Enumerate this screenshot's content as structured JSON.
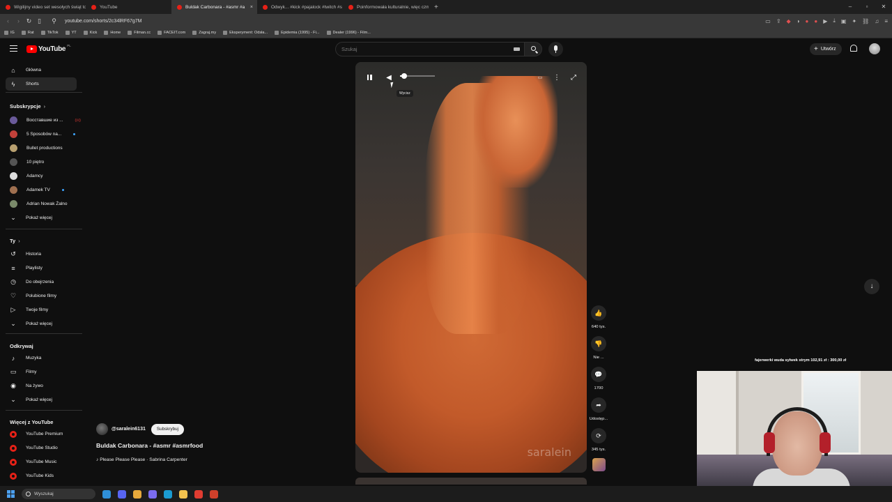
{
  "browser": {
    "tabs": [
      {
        "label": "Wigilijny video set wesołych świąt to",
        "active": false,
        "icon_color": "#e62117"
      },
      {
        "label": "YouTube",
        "active": false,
        "icon_color": "#e62117"
      },
      {
        "label": "Buldak Carbonara - #asmr #a",
        "active": true,
        "icon_color": "#e62117"
      },
      {
        "label": "Odwyk... #kick #pajalock #twitch #s",
        "active": false,
        "icon_color": "#e62117"
      },
      {
        "label": "Poinformowała kulturalnie, więc czm",
        "active": false,
        "icon_color": "#e62117"
      }
    ],
    "new_tab": "+",
    "url": "youtube.com/shorts/2c34lRF67g7M",
    "bookmarks": [
      "IG",
      "Rat",
      "TikTok",
      "YT",
      "Kick",
      "Home",
      "Filman.cc",
      "FACEIT.com",
      "Zagraj.my",
      "Eksperyment: Odsła...",
      "Epidemia (1995) - Fi...",
      "Dealer (1996) - Film..."
    ]
  },
  "youtube": {
    "logo_text": "YouTube",
    "logo_country": "PL",
    "search_placeholder": "Szukaj",
    "create_label": "Utwórz",
    "create_plus": "+",
    "sidebar": {
      "main": [
        {
          "label": "Główna",
          "icon": "home-icon",
          "glyph": "⌂",
          "active": false
        },
        {
          "label": "Shorts",
          "icon": "shorts-icon",
          "glyph": "ϟ",
          "active": true
        }
      ],
      "subs_header": "Subskrypcje",
      "subscriptions": [
        {
          "label": "Восставшие из ...",
          "color": "#6a5a9a",
          "live": true,
          "dot": false
        },
        {
          "label": "5 Sposobów na...",
          "color": "#c2413a",
          "live": false,
          "dot": true
        },
        {
          "label": "Bullet productions",
          "color": "#b8a070",
          "live": false,
          "dot": false
        },
        {
          "label": "10 piętro",
          "color": "#555555",
          "live": false,
          "dot": false
        },
        {
          "label": "Adamcy",
          "color": "#dddddd",
          "live": false,
          "dot": false
        },
        {
          "label": "Adamek TV",
          "color": "#a07050",
          "live": false,
          "dot": true
        },
        {
          "label": "Adrian Nowak Żalno",
          "color": "#7a8a6a",
          "live": false,
          "dot": false
        }
      ],
      "subs_more": "Pokaż więcej",
      "you_header": "Ty",
      "you": [
        {
          "label": "Historia",
          "glyph": "↺"
        },
        {
          "label": "Playlisty",
          "glyph": "≡"
        },
        {
          "label": "Do obejrzenia",
          "glyph": "◷"
        },
        {
          "label": "Polubione filmy",
          "glyph": "♡"
        },
        {
          "label": "Twoje filmy",
          "glyph": "▷"
        },
        {
          "label": "Pokaż więcej",
          "glyph": "⌄"
        }
      ],
      "explore_header": "Odkrywaj",
      "explore": [
        {
          "label": "Muzyka",
          "glyph": "♪"
        },
        {
          "label": "Filmy",
          "glyph": "▭"
        },
        {
          "label": "Na żywo",
          "glyph": "◉"
        },
        {
          "label": "Pokaż więcej",
          "glyph": "⌄"
        }
      ],
      "more_header": "Więcej z YouTube",
      "more": [
        "YouTube Premium",
        "YouTube Studio",
        "YouTube Music",
        "YouTube Kids"
      ]
    },
    "player": {
      "tooltip": "Wycisz",
      "watermark": "saralein",
      "volume_fraction": 0.12
    },
    "actions": [
      {
        "name": "like",
        "glyph": "👍",
        "label": "640 tys."
      },
      {
        "name": "dislike",
        "glyph": "👎",
        "label": "Nie ..."
      },
      {
        "name": "comments",
        "glyph": "💬",
        "label": "1700"
      },
      {
        "name": "share",
        "glyph": "➦",
        "label": "Udostęp..."
      },
      {
        "name": "remix",
        "glyph": "⟳",
        "label": "345 tys."
      }
    ],
    "short": {
      "channel": "@saralein6131",
      "subscribe": "Subskrybuj",
      "title": "Buldak Carbonara - #asmr #asmrfood",
      "music_note": "♪",
      "song": "Please Please Please · Sabrina Carpenter"
    }
  },
  "stream_overlay": {
    "ticker": "fajerwerki wuda sylwek strym 102,91 zł : 300,00 zł"
  },
  "taskbar": {
    "search_label": "Wyszukaj",
    "apps": [
      "#2f8fd8",
      "#5865f2",
      "#e8a93b",
      "#7b6cf0",
      "#1b9bd1",
      "#f2c14e",
      "#e03c31",
      "#d0402b"
    ]
  }
}
